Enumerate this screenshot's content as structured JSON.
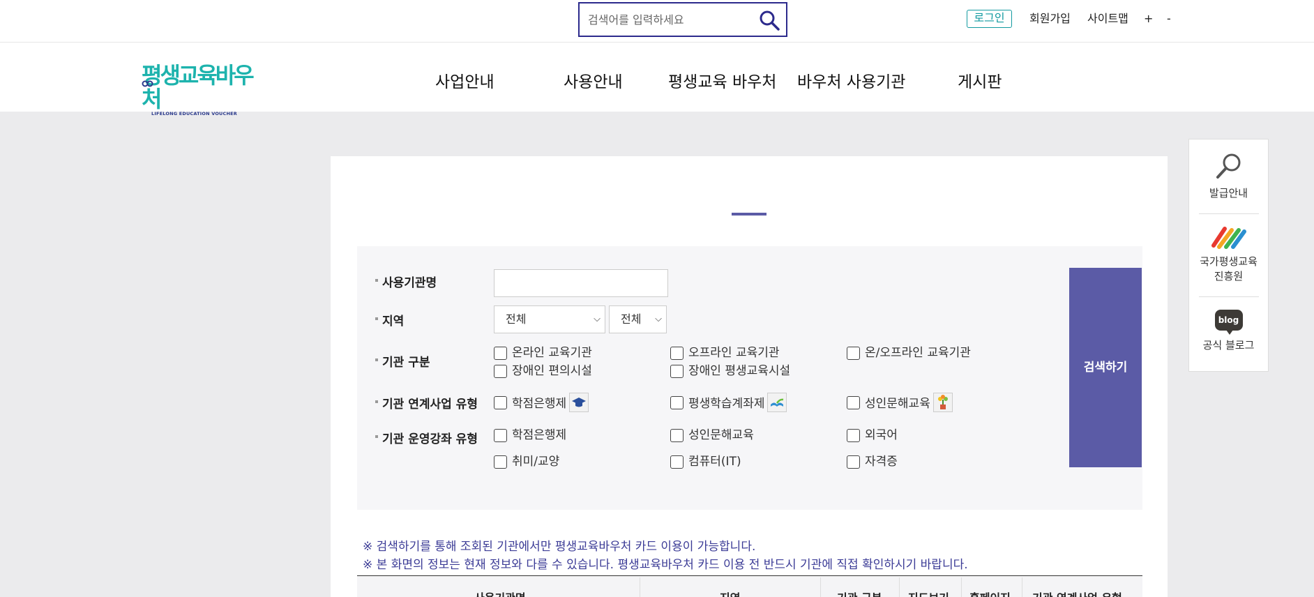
{
  "header": {
    "search": {
      "placeholder": "검색어를 입력하세요"
    },
    "util": {
      "login": "로그인",
      "signup": "회원가입",
      "sitemap": "사이트맵",
      "zoom_in": "+",
      "zoom_out": "-"
    }
  },
  "logo": {
    "main": "평생교육바우처",
    "sub": "LIFELONG EDUCATION VOUCHER"
  },
  "nav": {
    "items": [
      "사업안내",
      "사용안내",
      "평생교육 바우처",
      "바우처 사용기관",
      "게시판"
    ]
  },
  "quick": {
    "issue": "발급안내",
    "nile_line1": "국가평생교육",
    "nile_line2": "진흥원",
    "blog_icon_text": "blog",
    "blog": "공식 블로그"
  },
  "filter": {
    "labels": {
      "name": "사용기관명",
      "region": "지역",
      "type": "기관 구분",
      "program": "기관 연계사업 유형",
      "course": "기관 운영강좌 유형"
    },
    "name_value": "",
    "region1": "전체",
    "region2": "전체",
    "type_options": [
      "온라인 교육기관",
      "오프라인 교육기관",
      "온/오프라인 교육기관",
      "장애인 편의시설",
      "장애인 평생교육시설"
    ],
    "program_options": [
      "학점은행제",
      "평생학습계좌제",
      "성인문해교육"
    ],
    "course_options": [
      "학점은행제",
      "성인문해교육",
      "외국어",
      "취미/교양",
      "컴퓨터(IT)",
      "자격증"
    ],
    "submit": "검색하기"
  },
  "notices": [
    "※ 검색하기를 통해 조회된 기관에서만 평생교육바우처 카드 이용이 가능합니다.",
    "※ 본 화면의 정보는 현재 정보와 다를 수 있습니다. 평생교육바우처 카드 이용 전 반드시 기관에 직접 확인하시기 바랍니다."
  ],
  "table": {
    "headers": [
      "사용기관명",
      "지역",
      "기관 구분",
      "지도보기",
      "홈페이지",
      "기관 연계사업 유형"
    ]
  },
  "colors": {
    "accent": "#5b5ba6",
    "brand": "#1db3ad",
    "search_border": "#2c2a8c"
  }
}
